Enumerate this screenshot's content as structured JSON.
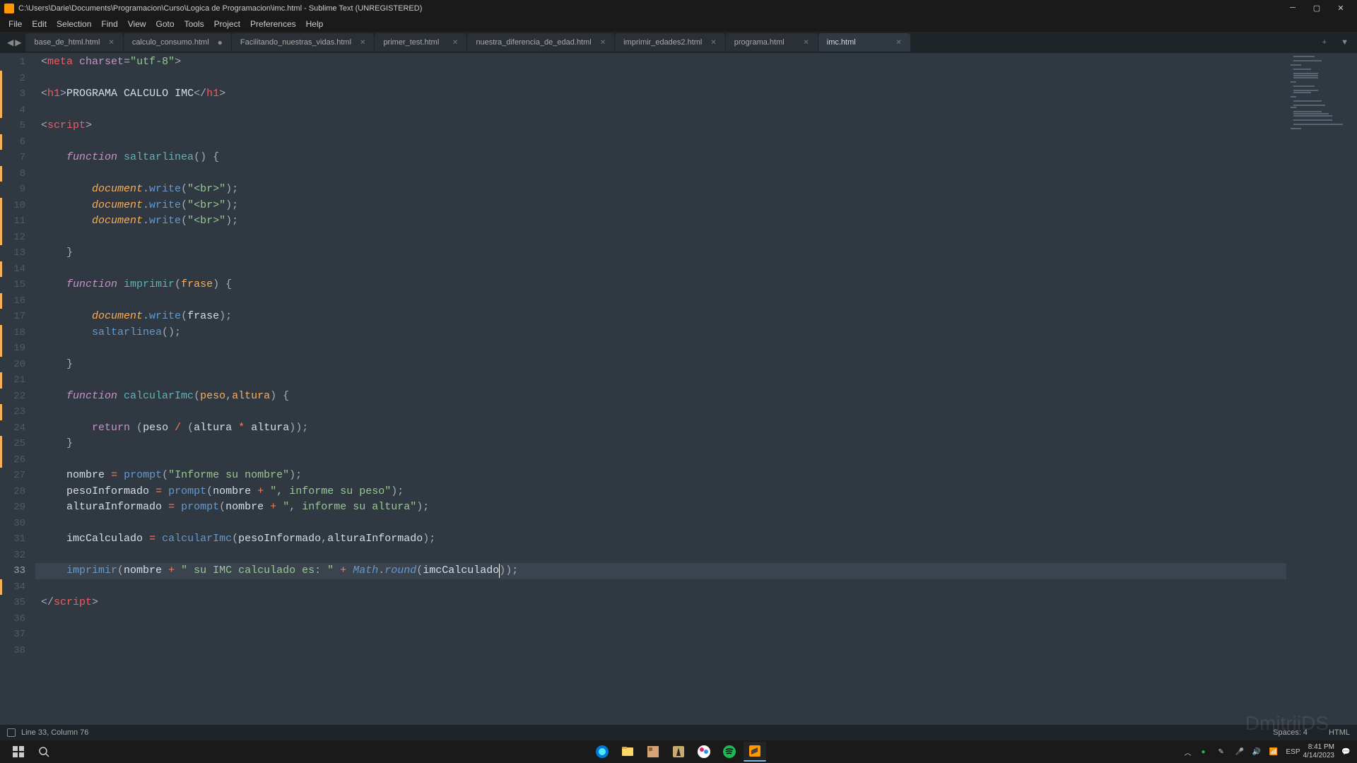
{
  "window": {
    "title": "C:\\Users\\Darie\\Documents\\Programacion\\Curso\\Logica de Programacion\\imc.html - Sublime Text (UNREGISTERED)"
  },
  "menu": {
    "items": [
      "File",
      "Edit",
      "Selection",
      "Find",
      "View",
      "Goto",
      "Tools",
      "Project",
      "Preferences",
      "Help"
    ]
  },
  "tabs": {
    "items": [
      {
        "label": "base_de_html.html",
        "dirty": false,
        "active": false
      },
      {
        "label": "calculo_consumo.html",
        "dirty": true,
        "active": false
      },
      {
        "label": "Facilitando_nuestras_vidas.html",
        "dirty": false,
        "active": false
      },
      {
        "label": "primer_test.html",
        "dirty": false,
        "active": false
      },
      {
        "label": "nuestra_diferencia_de_edad.html",
        "dirty": false,
        "active": false
      },
      {
        "label": "imprimir_edades2.html",
        "dirty": false,
        "active": false
      },
      {
        "label": "programa.html",
        "dirty": false,
        "active": false
      },
      {
        "label": "imc.html",
        "dirty": false,
        "active": true
      }
    ]
  },
  "editor": {
    "total_lines": 38,
    "markers": [
      1,
      2,
      3,
      5,
      7,
      9,
      10,
      11,
      13,
      15,
      17,
      18,
      20,
      22,
      24,
      25,
      33
    ],
    "current_line": 33,
    "cursor_col": 76
  },
  "statusbar": {
    "position": "Line 33, Column 76",
    "spaces": "Spaces: 4",
    "syntax": "HTML"
  },
  "tray": {
    "lang": "ESP",
    "time": "8:41 PM",
    "date": "4/14/2023"
  },
  "watermark": "DmitriiDS"
}
